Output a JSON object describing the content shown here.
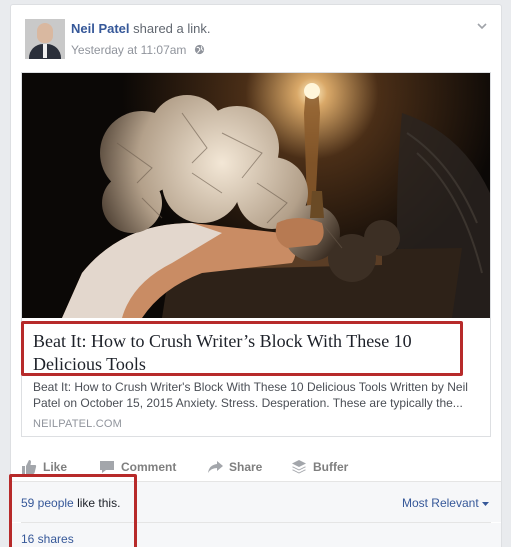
{
  "post": {
    "author": "Neil Patel",
    "action_text": "shared a link.",
    "timestamp": "Yesterday at 11:07am",
    "privacy_icon": "globe-icon"
  },
  "link": {
    "title": "Beat It: How to Crush Writer’s Block With These 10 Delicious Tools",
    "description": "Beat It: How to Crush Writer's Block With These 10 Delicious Tools Written by Neil Patel on October 15, 2015 Anxiety. Stress. Desperation. These are typically the...",
    "domain": "NEILPATEL.COM"
  },
  "actions": {
    "like": "Like",
    "comment": "Comment",
    "share": "Share",
    "buffer": "Buffer"
  },
  "reactions": {
    "people_link": "59 people",
    "suffix": "like this.",
    "sort": "Most Relevant",
    "shares": "16 shares"
  },
  "colors": {
    "link": "#365899",
    "highlight": "#b72a2a"
  }
}
